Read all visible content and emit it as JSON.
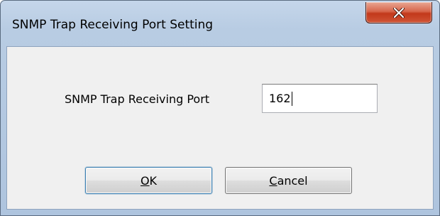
{
  "window": {
    "title": "SNMP Trap Receiving Port Setting"
  },
  "form": {
    "port_label": "SNMP Trap Receiving Port",
    "port_value": "162"
  },
  "buttons": {
    "ok_accel": "O",
    "ok_rest": "K",
    "cancel_accel": "C",
    "cancel_rest": "ancel"
  },
  "icons": {
    "close": "close-icon"
  },
  "colors": {
    "close_button": "#c7452a",
    "title_bar": "#b8cce3",
    "client_area": "#f0f0f0",
    "default_button_border": "#3c7fb1"
  }
}
